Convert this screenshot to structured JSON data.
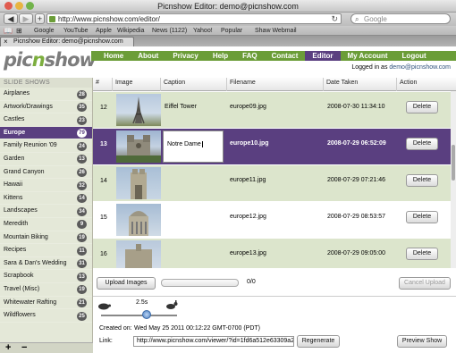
{
  "browser": {
    "window_title": "Picnshow Editor: demo@picnshow.com",
    "url": "http://www.picnshow.com/editor/",
    "search_placeholder": "Google",
    "bookmarks": [
      "Google",
      "YouTube",
      "Apple",
      "Wikipedia",
      "News (1122)",
      "Yahoo!",
      "Popular",
      "Shaw Webmail"
    ],
    "tab_title": "Picnshow Editor: demo@picnshow.com"
  },
  "site": {
    "logo_left": "pic",
    "logo_x": "n",
    "logo_right": "show",
    "nav": [
      "Home",
      "About",
      "Privacy",
      "Help",
      "FAQ",
      "Contact",
      "Editor",
      "My Account",
      "Logout"
    ],
    "active_nav": "Editor",
    "logged_in_prefix": "Logged in as ",
    "logged_in_email": "demo@picnshow.com"
  },
  "sidebar": {
    "heading": "SLIDE SHOWS",
    "items": [
      {
        "label": "Airplanes",
        "count": "28"
      },
      {
        "label": "Artwork/Drawings",
        "count": "35"
      },
      {
        "label": "Castles",
        "count": "23"
      },
      {
        "label": "Europe",
        "count": "79"
      },
      {
        "label": "Family Reunion '09",
        "count": "24"
      },
      {
        "label": "Garden",
        "count": "13"
      },
      {
        "label": "Grand Canyon",
        "count": "26"
      },
      {
        "label": "Hawaii",
        "count": "32"
      },
      {
        "label": "Kittens",
        "count": "14"
      },
      {
        "label": "Landscapes",
        "count": "34"
      },
      {
        "label": "Meredith",
        "count": "9"
      },
      {
        "label": "Mountain Biking",
        "count": "19"
      },
      {
        "label": "Recipes",
        "count": "11"
      },
      {
        "label": "Sara & Dan's Wedding",
        "count": "31"
      },
      {
        "label": "Scrapbook",
        "count": "13"
      },
      {
        "label": "Travel (Misc)",
        "count": "19"
      },
      {
        "label": "Whitewater Rafting",
        "count": "21"
      },
      {
        "label": "Wildflowers",
        "count": "25"
      }
    ],
    "selected": "Europe",
    "add_label": "+",
    "remove_label": "−"
  },
  "table": {
    "headers": [
      "#",
      "Image",
      "Caption",
      "Filename",
      "Date Taken",
      "Action"
    ],
    "rows": [
      {
        "num": "12",
        "caption": "Eiffel Tower",
        "filename": "europe09.jpg",
        "date": "2008-07-30 11:34:10",
        "action": "Delete"
      },
      {
        "num": "13",
        "caption": "Notre Dame",
        "filename": "europe10.jpg",
        "date": "2008-07-29 06:52:09",
        "action": "Delete"
      },
      {
        "num": "14",
        "caption": "",
        "filename": "europe11.jpg",
        "date": "2008-07-29 07:21:46",
        "action": "Delete"
      },
      {
        "num": "15",
        "caption": "",
        "filename": "europe12.jpg",
        "date": "2008-07-29 08:53:57",
        "action": "Delete"
      },
      {
        "num": "16",
        "caption": "",
        "filename": "europe13.jpg",
        "date": "2008-07-29 09:05:00",
        "action": "Delete"
      }
    ]
  },
  "upload": {
    "upload_label": "Upload Images",
    "progress_text": "0/0",
    "progress_fraction": 0,
    "cancel_label": "Cancel Upload"
  },
  "slideshow": {
    "speed": "2.5s",
    "speed_fraction": 0.6,
    "created_label": "Created on:",
    "created_value": "Wed May 25 2011 00:12:22 GMT-0700 (PDT)",
    "link_label": "Link:",
    "link_value": "http://www.picnshow.com/viewer/?id=1fd6a512e63309a2",
    "regenerate_label": "Regenerate",
    "preview_label": "Preview Show"
  }
}
